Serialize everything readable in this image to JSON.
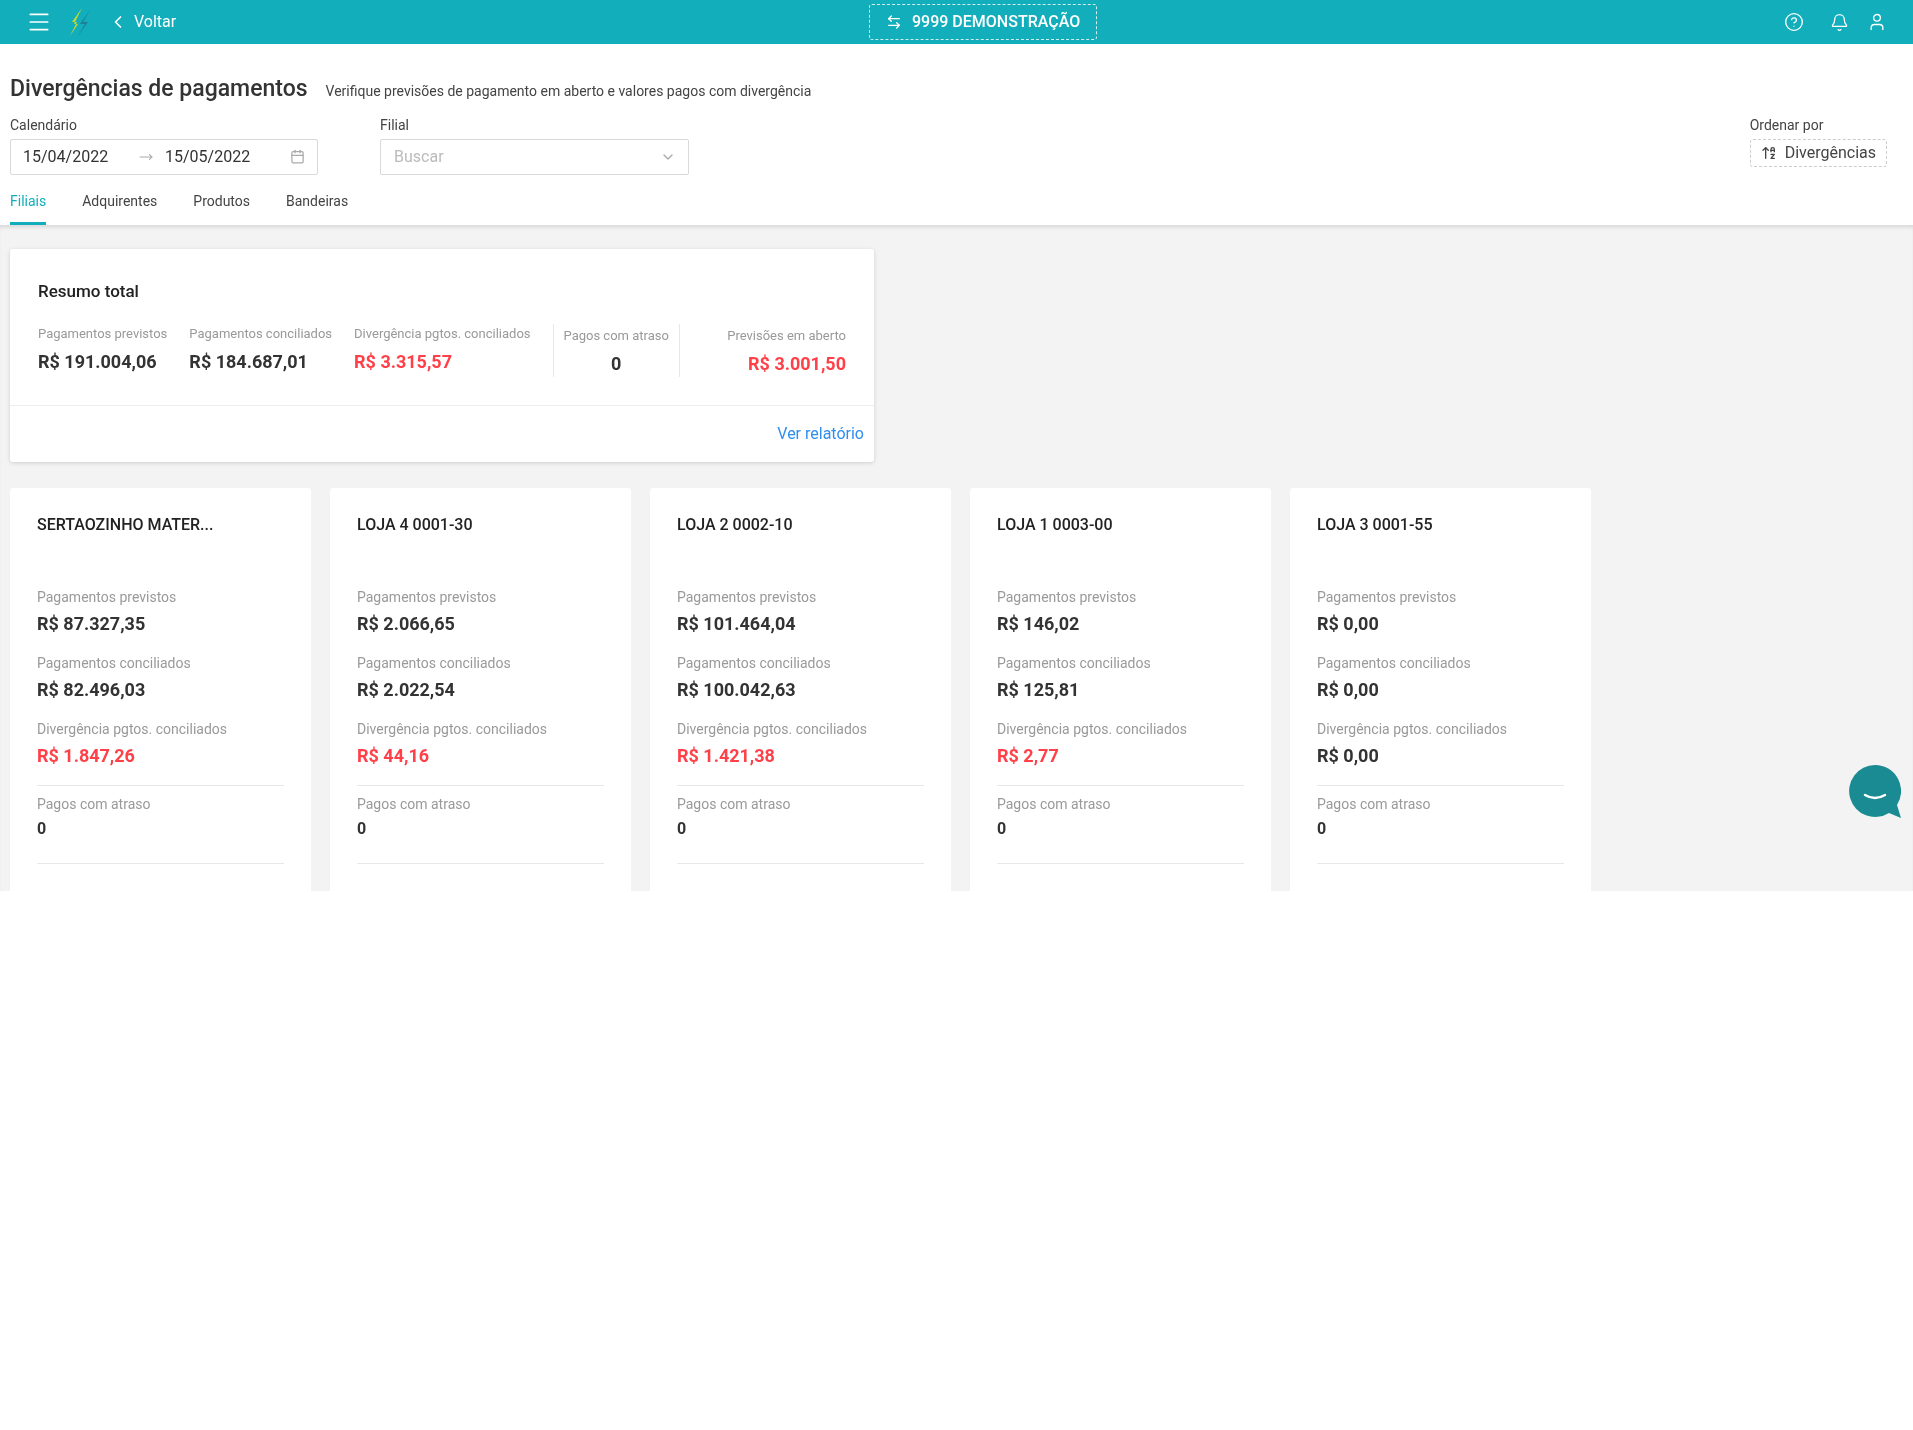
{
  "topbar": {
    "back": "Voltar",
    "company": "9999 DEMONSTRAÇÃO"
  },
  "header": {
    "title": "Divergências de pagamentos",
    "subtitle": "Verifique previsões de pagamento em aberto e valores pagos com divergência"
  },
  "filters": {
    "calendar": {
      "label": "Calendário",
      "start": "15/04/2022",
      "end": "15/05/2022"
    },
    "branch": {
      "label": "Filial",
      "placeholder": "Buscar"
    },
    "sort": {
      "label": "Ordenar por",
      "value": "Divergências"
    }
  },
  "tabs": [
    {
      "label": "Filiais",
      "selected": true
    },
    {
      "label": "Adquirentes",
      "selected": false
    },
    {
      "label": "Produtos",
      "selected": false
    },
    {
      "label": "Bandeiras",
      "selected": false
    }
  ],
  "summary": {
    "title": "Resumo total",
    "metrics": [
      {
        "label": "Pagamentos previstos",
        "value": "R$ 191.004,06",
        "alert": false,
        "kind": "plain"
      },
      {
        "label": "Pagamentos conciliados",
        "value": "R$ 184.687,01",
        "alert": false,
        "kind": "plain"
      },
      {
        "label": "Divergência pgtos. conciliados",
        "value": "R$ 3.315,57",
        "alert": true,
        "kind": "plain"
      },
      {
        "label": "Pagos com atraso",
        "value": "0",
        "alert": false,
        "kind": "center"
      },
      {
        "label": "Previsões em aberto",
        "value": "R$ 3.001,50",
        "alert": true,
        "kind": "right"
      }
    ],
    "link": "Ver relatório"
  },
  "stores": [
    {
      "name": "SERTAOZINHO MATER...",
      "metrics": [
        {
          "label": "Pagamentos previstos",
          "value": "R$ 87.327,35",
          "alert": false
        },
        {
          "label": "Pagamentos conciliados",
          "value": "R$ 82.496,03",
          "alert": false
        },
        {
          "label": "Divergência pgtos. conciliados",
          "value": "R$ 1.847,26",
          "alert": true
        }
      ],
      "late": {
        "label": "Pagos com atraso",
        "value": "0"
      }
    },
    {
      "name": "LOJA 4 0001-30",
      "metrics": [
        {
          "label": "Pagamentos previstos",
          "value": "R$ 2.066,65",
          "alert": false
        },
        {
          "label": "Pagamentos conciliados",
          "value": "R$ 2.022,54",
          "alert": false
        },
        {
          "label": "Divergência pgtos. conciliados",
          "value": "R$ 44,16",
          "alert": true
        }
      ],
      "late": {
        "label": "Pagos com atraso",
        "value": "0"
      }
    },
    {
      "name": "LOJA 2 0002-10",
      "metrics": [
        {
          "label": "Pagamentos previstos",
          "value": "R$ 101.464,04",
          "alert": false
        },
        {
          "label": "Pagamentos conciliados",
          "value": "R$ 100.042,63",
          "alert": false
        },
        {
          "label": "Divergência pgtos. conciliados",
          "value": "R$ 1.421,38",
          "alert": true
        }
      ],
      "late": {
        "label": "Pagos com atraso",
        "value": "0"
      }
    },
    {
      "name": "LOJA 1 0003-00",
      "metrics": [
        {
          "label": "Pagamentos previstos",
          "value": "R$ 146,02",
          "alert": false
        },
        {
          "label": "Pagamentos conciliados",
          "value": "R$ 125,81",
          "alert": false
        },
        {
          "label": "Divergência pgtos. conciliados",
          "value": "R$ 2,77",
          "alert": true
        }
      ],
      "late": {
        "label": "Pagos com atraso",
        "value": "0"
      }
    },
    {
      "name": "LOJA 3 0001-55",
      "metrics": [
        {
          "label": "Pagamentos previstos",
          "value": "R$ 0,00",
          "alert": false
        },
        {
          "label": "Pagamentos conciliados",
          "value": "R$ 0,00",
          "alert": false
        },
        {
          "label": "Divergência pgtos. conciliados",
          "value": "R$ 0,00",
          "alert": false
        }
      ],
      "late": {
        "label": "Pagos com atraso",
        "value": "0"
      }
    }
  ]
}
